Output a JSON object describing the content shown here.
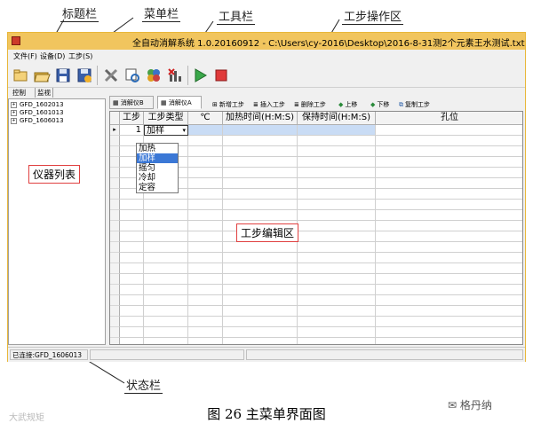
{
  "callouts": {
    "title_bar": "标题栏",
    "menu_bar": "菜单栏",
    "toolbar": "工具栏",
    "step_area": "工步操作区",
    "status_bar": "状态栏",
    "instrument_list": "仪器列表",
    "step_edit": "工步编辑区"
  },
  "window": {
    "title": "全自动消解系统 1.0.20160912 - C:\\Users\\cy-2016\\Desktop\\2016-8-31测2个元素王水测试.txt"
  },
  "menu": [
    "文件(F)",
    "设备(D)",
    "工步(S)"
  ],
  "left_tabs": [
    "控制",
    "监视"
  ],
  "instruments": [
    "GFD_1602013",
    "GFD_1601013",
    "GFD_1606013"
  ],
  "device_tabs": [
    "消解仪B",
    "消解仪A"
  ],
  "step_buttons": [
    "新增工步",
    "插入工步",
    "删除工步",
    "上移",
    "下移",
    "复制工步"
  ],
  "grid": {
    "columns": [
      "工步",
      "工步类型",
      "℃",
      "加热时间(H:M:S)",
      "保持时间(H:M:S)",
      "孔位"
    ],
    "row1": {
      "step": "1",
      "type": "加样"
    },
    "dropdown_options": [
      "加热",
      "加样",
      "摇匀",
      "冷却",
      "定容"
    ],
    "dropdown_selected_index": 1
  },
  "status": {
    "connection": "已连接:GFD_1606013"
  },
  "caption": "图 26 主菜单界面图",
  "watermark_left": "大武规矩",
  "watermark_right": "格丹纳",
  "colors": {
    "titlebar": "#f1c55e",
    "selected_row": "#c9dcf5",
    "dropdown_selected": "#3b78d6",
    "callout_box": "#e04040"
  }
}
